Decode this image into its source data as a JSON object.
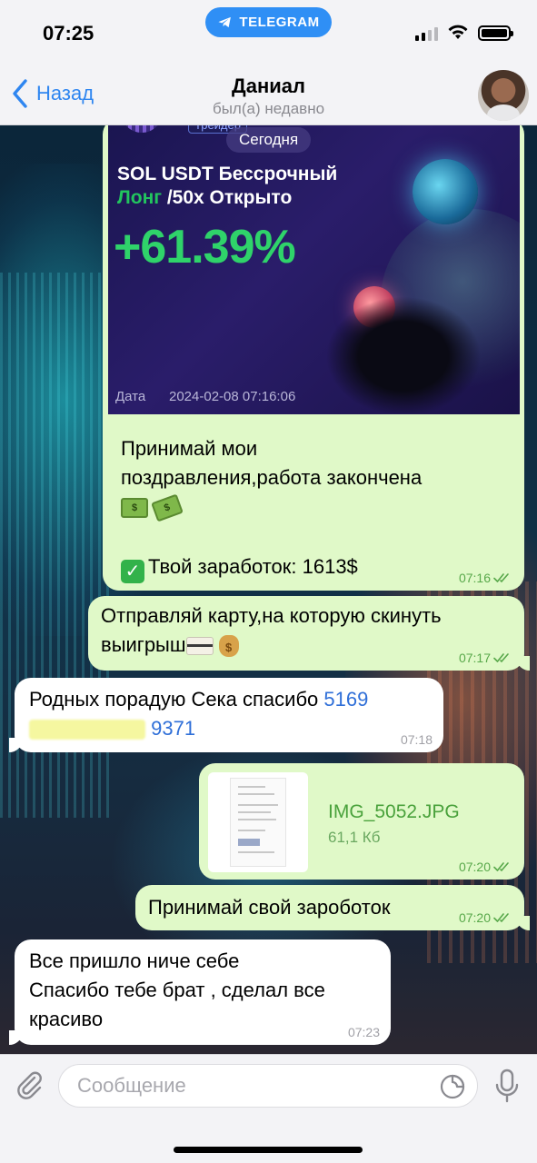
{
  "status_bar": {
    "time": "07:25",
    "app_pill": "TELEGRAM"
  },
  "header": {
    "back_label": "Назад",
    "contact_name": "Даниал",
    "contact_status": "был(а) недавно"
  },
  "trade_card": {
    "trader_tag": "Трейдер",
    "date_pill": "Сегодня",
    "title_line1": "SOL USDT Бессрочный",
    "title_long": "Лонг",
    "title_line2_rest": " /50x Открыто",
    "percent": "+61.39%",
    "date_label": "Дата",
    "date_value": "2024-02-08 07:16:06"
  },
  "messages": [
    {
      "id": "m1",
      "direction": "out",
      "line1": "Принимай мои",
      "line2": "поздравления,работа закончена",
      "earn_label": "Твой заработок: 1613$",
      "time": "07:16"
    },
    {
      "id": "m2",
      "direction": "out",
      "line1": "Отправляй карту,на которую скинуть",
      "line2": "выигрыш",
      "time": "07:17"
    },
    {
      "id": "m3",
      "direction": "in",
      "text": "Родных порадую Сека спасибо ",
      "card_start": "5169",
      "card_end": "9371",
      "time": "07:18"
    },
    {
      "id": "m4",
      "direction": "out",
      "file_name": "IMG_5052.JPG",
      "file_size": "61,1 Кб",
      "time": "07:20"
    },
    {
      "id": "m5",
      "direction": "out",
      "text": "Принимай свой зароботок",
      "time": "07:20"
    },
    {
      "id": "m6",
      "direction": "in",
      "line1": "Все пришло ниче себе",
      "line2": "Спасибо тебе брат , сделал все",
      "line3": "красиво",
      "time": "07:23"
    }
  ],
  "composer": {
    "placeholder": "Сообщение"
  },
  "colors": {
    "accent": "#2f86f0",
    "outgoing_bubble": "#e0f9c8",
    "incoming_bubble": "#ffffff",
    "profit_green": "#2fd36a"
  }
}
